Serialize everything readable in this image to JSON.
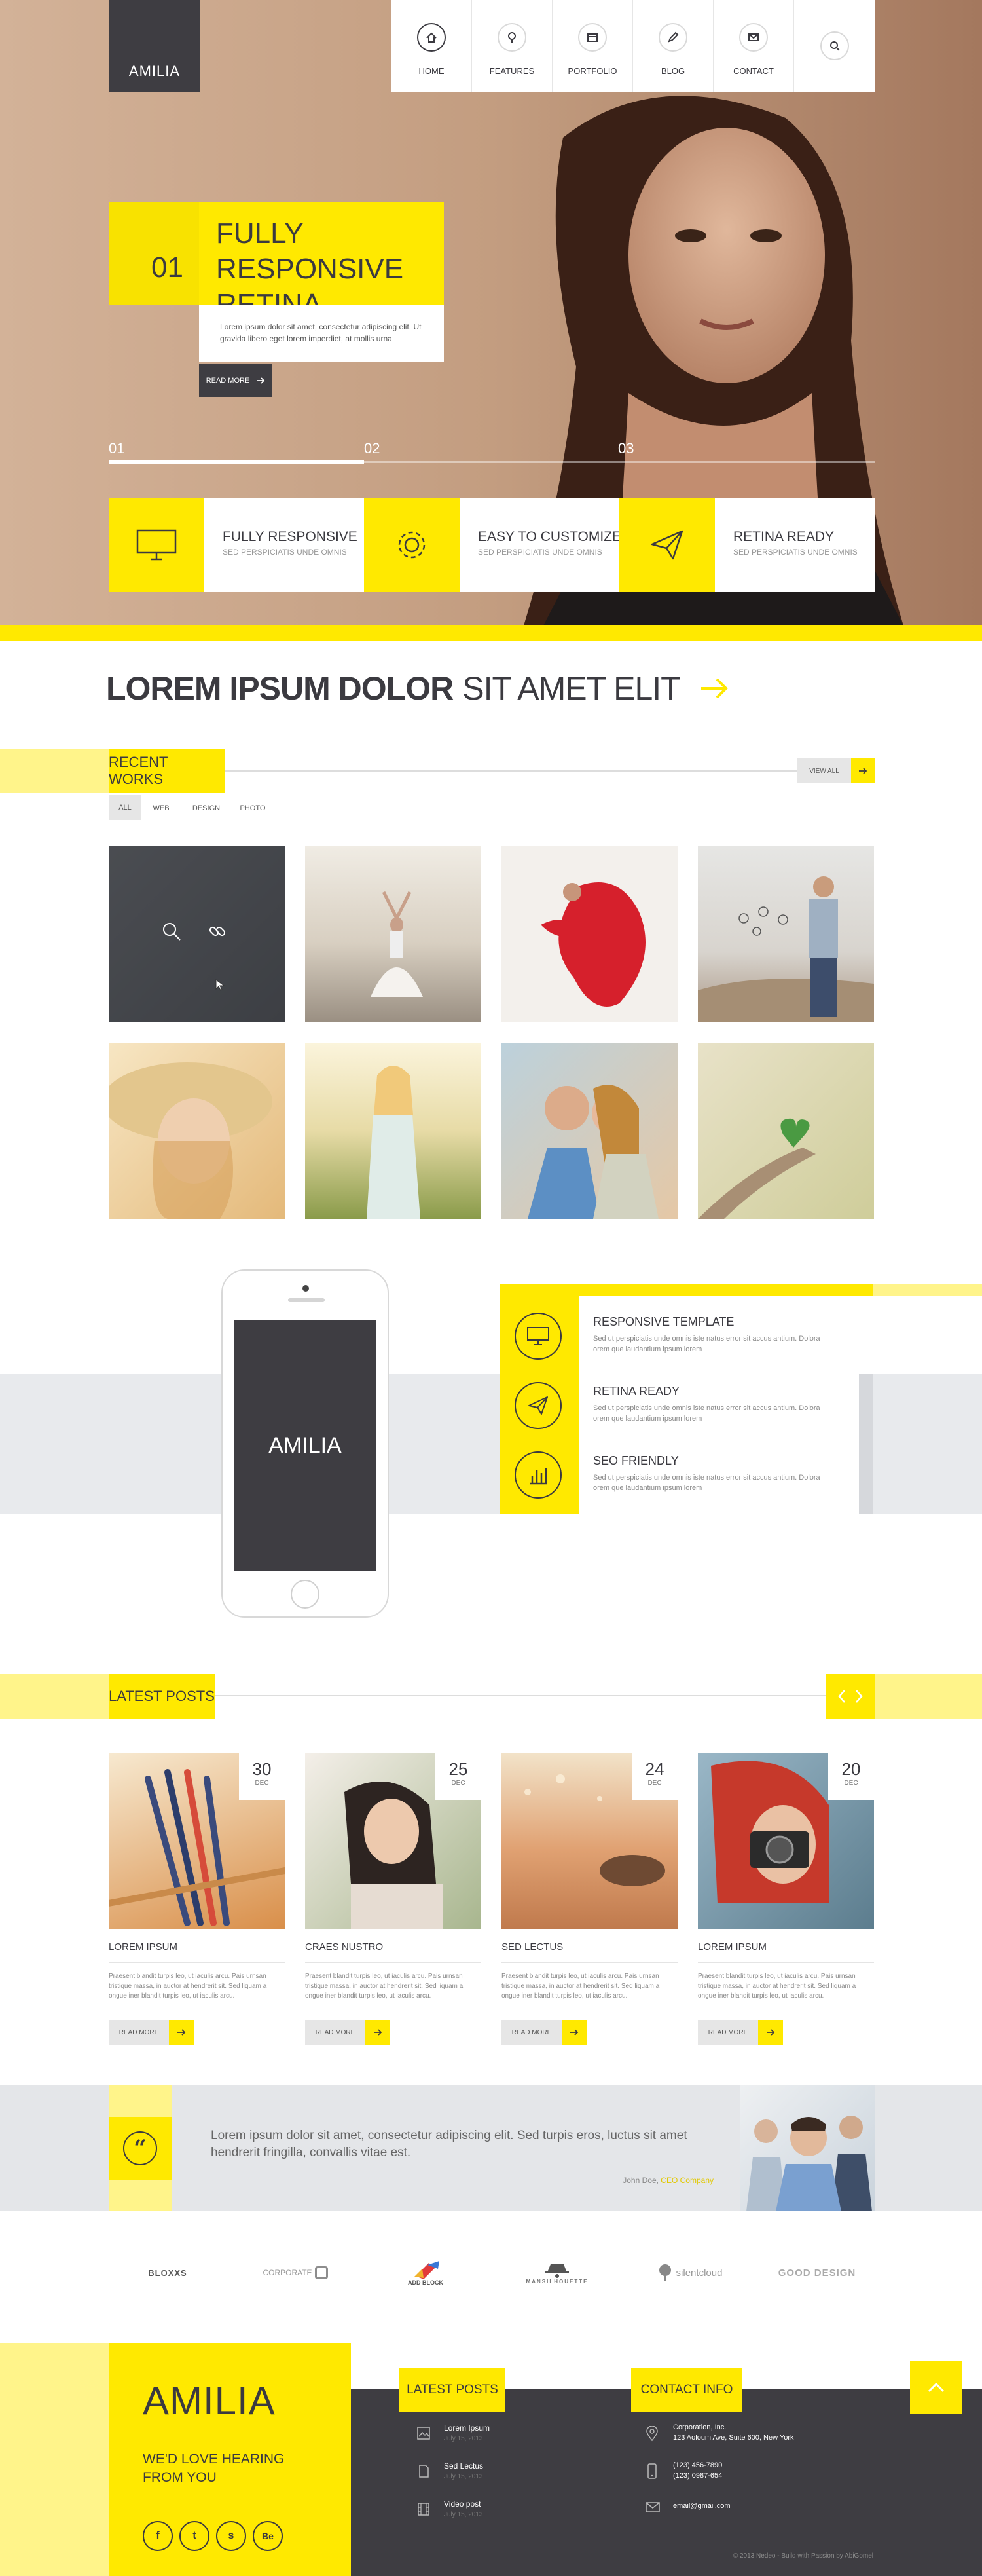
{
  "brand": {
    "name": "AMILIA"
  },
  "nav": {
    "items": [
      {
        "label": "HOME",
        "icon": "home-icon"
      },
      {
        "label": "FEATURES",
        "icon": "lightbulb-icon"
      },
      {
        "label": "PORTFOLIO",
        "icon": "portfolio-icon"
      },
      {
        "label": "BLOG",
        "icon": "pencil-icon"
      },
      {
        "label": "CONTACT",
        "icon": "mail-icon"
      },
      {
        "label": "",
        "icon": "search-icon"
      }
    ]
  },
  "hero": {
    "slide_number": "01",
    "title_line1": "FULLY RESPONSIVE",
    "title_line2": "RETINA READY",
    "text": "Lorem ipsum dolor sit amet, consectetur adipiscing elit. Ut gravida libero eget lorem imperdiet, at mollis urna",
    "button": "READ MORE",
    "progress_labels": [
      "01",
      "02",
      "03"
    ],
    "features": [
      {
        "title": "FULLY RESPONSIVE",
        "subtitle": "SED PERSPICIATIS UNDE OMNIS",
        "icon": "monitor-icon"
      },
      {
        "title": "EASY TO CUSTOMIZE",
        "subtitle": "SED PERSPICIATIS UNDE OMNIS",
        "icon": "gear-icon"
      },
      {
        "title": "RETINA READY",
        "subtitle": "SED PERSPICIATIS UNDE OMNIS",
        "icon": "paper-plane-icon"
      }
    ]
  },
  "headline": {
    "bold": "LOREM IPSUM DOLOR",
    "light": "SIT AMET ELIT"
  },
  "recent_works": {
    "title": "RECENT WORKS",
    "view_all": "VIEW ALL",
    "filters": [
      "ALL",
      "WEB",
      "DESIGN",
      "PHOTO"
    ]
  },
  "showcase": {
    "phone_label": "AMILIA",
    "features": [
      {
        "title": "RESPONSIVE TEMPLATE",
        "text": "Sed ut perspiciatis unde omnis iste natus error sit accus antium. Dolora orem que laudantium ipsum lorem",
        "icon": "monitor-icon"
      },
      {
        "title": "RETINA READY",
        "text": "Sed ut perspiciatis unde omnis iste natus error sit accus antium. Dolora orem que laudantium ipsum lorem",
        "icon": "paper-plane-icon"
      },
      {
        "title": "SEO FRIENDLY",
        "text": "Sed ut perspiciatis unde omnis iste natus error sit accus antium. Dolora orem que laudantium ipsum lorem",
        "icon": "chart-icon"
      }
    ]
  },
  "latest_posts": {
    "title": "LATEST POSTS",
    "posts": [
      {
        "day": "30",
        "month": "DEC",
        "title": "LOREM IPSUM",
        "text": "Praesent blandit turpis leo, ut iaculis arcu. Pais urnsan tristique massa, in auctor at hendrerit sit. Sed liquam a ongue iner blandit turpis leo, ut iaculis arcu.",
        "button": "READ MORE"
      },
      {
        "day": "25",
        "month": "DEC",
        "title": "CRAES NUSTRO",
        "text": "Praesent blandit turpis leo, ut iaculis arcu. Pais urnsan tristique massa, in auctor at hendrerit sit. Sed liquam a ongue iner blandit turpis leo, ut iaculis arcu.",
        "button": "READ MORE"
      },
      {
        "day": "24",
        "month": "DEC",
        "title": "SED LECTUS",
        "text": "Praesent blandit turpis leo, ut iaculis arcu. Pais urnsan tristique massa, in auctor at hendrerit sit. Sed liquam a ongue iner blandit turpis leo, ut iaculis arcu.",
        "button": "READ MORE"
      },
      {
        "day": "20",
        "month": "DEC",
        "title": "LOREM IPSUM",
        "text": "Praesent blandit turpis leo, ut iaculis arcu. Pais urnsan tristique massa, in auctor at hendrerit sit. Sed liquam a ongue iner blandit turpis leo, ut iaculis arcu.",
        "button": "READ MORE"
      }
    ]
  },
  "testimonial": {
    "quote": "Lorem ipsum dolor sit amet, consectetur adipiscing elit. Sed turpis eros, luctus sit amet hendrerit fringilla, convallis vitae est.",
    "author": "John Doe,",
    "company": "CEO Company"
  },
  "clients": [
    "BLOXXS",
    "CORPORATE",
    "ADD BLOCK",
    "MANSILHOUETTE",
    "silentcloud",
    "GOOD DESIGN"
  ],
  "footer": {
    "brand": "AMILIA",
    "tagline1": "WE'D LOVE HEARING",
    "tagline2": "FROM YOU",
    "social": [
      "f",
      "t",
      "s",
      "Be"
    ],
    "posts_title": "LATEST POSTS",
    "posts": [
      {
        "title": "Lorem Ipsum",
        "date": "July 15, 2013",
        "icon": "image-icon"
      },
      {
        "title": "Sed Lectus",
        "date": "July 15, 2013",
        "icon": "document-icon"
      },
      {
        "title": "Video post",
        "date": "July 15, 2013",
        "icon": "film-icon"
      }
    ],
    "contact_title": "CONTACT INFO",
    "address1": "Corporation, Inc.",
    "address2": "123 Aoloum Ave, Suite 600, New York",
    "phone1": "(123) 456-7890",
    "phone2": "(123) 0987-654",
    "email": "email@gmail.com",
    "copyright": "© 2013 Nedeo - Build with Passion by AbiGomel"
  },
  "colors": {
    "accent": "#ffe900",
    "accent_pale": "#fff48a",
    "dark": "#3e3d42"
  }
}
